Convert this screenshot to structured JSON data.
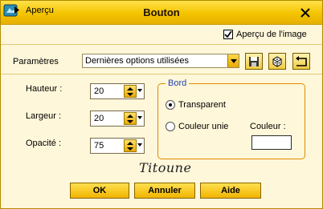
{
  "window": {
    "title": "Bouton"
  },
  "preview": {
    "label": "Aperçu",
    "preview_image_label": "Aperçu de l'image",
    "preview_image_checked": true
  },
  "params": {
    "label": "Paramètres",
    "preset_value": "Dernières options utilisées"
  },
  "fields": [
    {
      "label": "Hauteur :",
      "value": "20"
    },
    {
      "label": "Largeur :",
      "value": "20"
    },
    {
      "label": "Opacité :",
      "value": "75"
    }
  ],
  "border": {
    "title": "Bord",
    "options": [
      {
        "label": "Transparent",
        "selected": true
      },
      {
        "label": "Couleur unie",
        "selected": false
      }
    ],
    "color_label": "Couleur :",
    "color_value": "#ffffff"
  },
  "signature": "Titoune",
  "buttons": {
    "ok": "OK",
    "cancel": "Annuler",
    "help": "Aide"
  },
  "colors": {
    "titlebar": "#f4c400",
    "accent_border": "#e08a00",
    "group_title": "#2040b0"
  }
}
